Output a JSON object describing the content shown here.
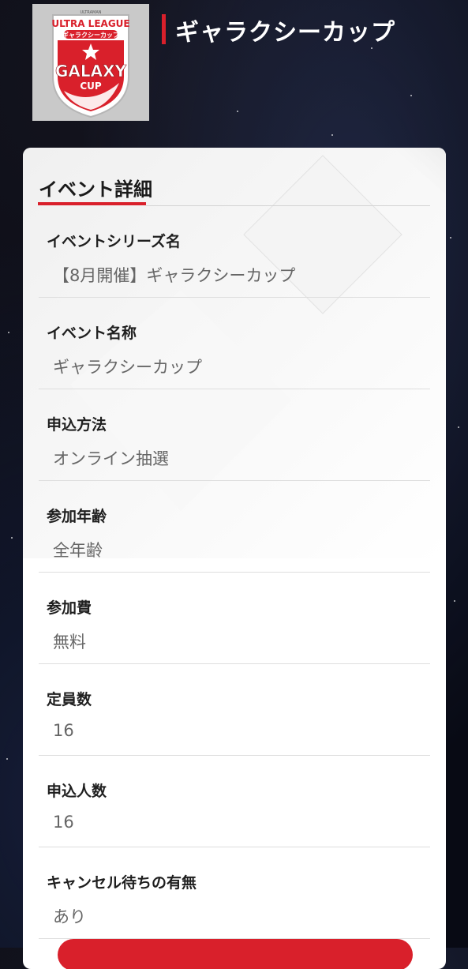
{
  "header": {
    "logo": {
      "top_text": "ULTRA LEAGUE",
      "sub_text": "ギャラクシーカップ",
      "main_text": "GALAXY",
      "cup_text": "CUP",
      "tiny_text": "ULTRAMAN"
    },
    "title": "ギャラクシーカップ"
  },
  "card": {
    "section_title": "イベント詳細",
    "rows": [
      {
        "label": "イベントシリーズ名",
        "value": "【8月開催】ギャラクシーカップ"
      },
      {
        "label": "イベント名称",
        "value": "ギャラクシーカップ"
      },
      {
        "label": "申込方法",
        "value": "オンライン抽選"
      },
      {
        "label": "参加年齢",
        "value": "全年齢"
      },
      {
        "label": "参加費",
        "value": "無料"
      },
      {
        "label": "定員数",
        "value": "16"
      },
      {
        "label": "申込人数",
        "value": "16"
      },
      {
        "label": "キャンセル待ちの有無",
        "value": "あり"
      }
    ]
  },
  "colors": {
    "accent": "#d9202b",
    "background": "#0b1020",
    "card": "#ffffff",
    "label": "#1f1f1f",
    "value": "#666666"
  }
}
